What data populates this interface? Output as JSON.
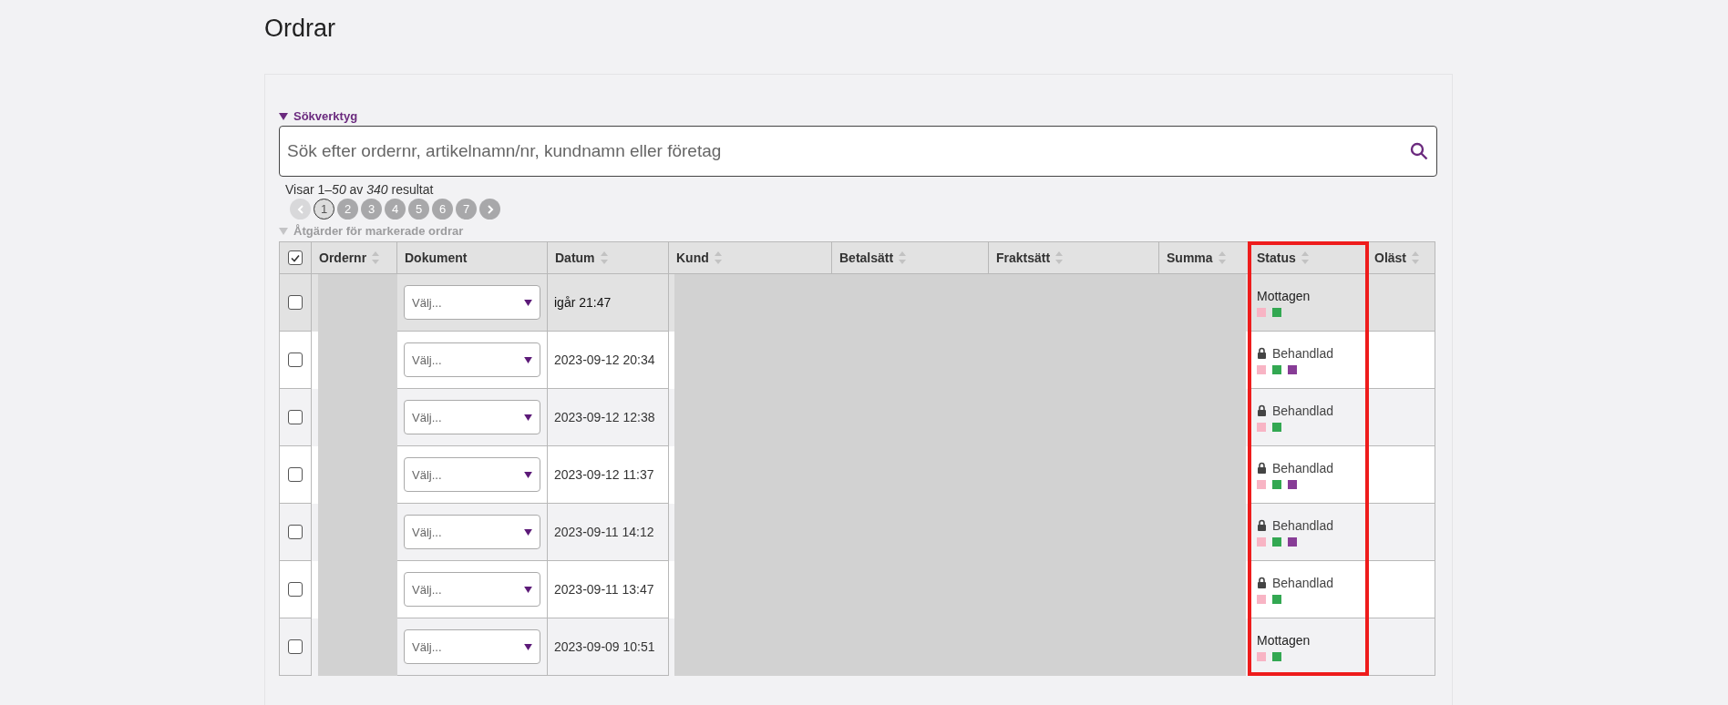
{
  "page": {
    "title": "Ordrar"
  },
  "search_tools": {
    "label": "Sökverktyg",
    "expanded": true,
    "placeholder": "Sök efter ordernr, artikelnamn/nr, kundnamn eller företag"
  },
  "results": "Visar 1–*50* av *340* resultat",
  "pagination": {
    "prev_disabled": true,
    "next_disabled": false,
    "pages": [
      {
        "label": "1",
        "selected": true
      },
      {
        "label": "2",
        "selected": false
      },
      {
        "label": "3",
        "selected": false
      },
      {
        "label": "4",
        "selected": false
      },
      {
        "label": "5",
        "selected": false
      },
      {
        "label": "6",
        "selected": false
      },
      {
        "label": "7",
        "selected": false
      }
    ]
  },
  "bulk_actions": {
    "label": "Åtgärder för markerade ordrar",
    "disabled": true
  },
  "table": {
    "select_all_checked": true,
    "columns": [
      {
        "label": "Ordernr",
        "sortable": true,
        "highlighted": false
      },
      {
        "label": "Dokument",
        "sortable": false,
        "highlighted": false
      },
      {
        "label": "Datum",
        "sortable": true,
        "highlighted": false
      },
      {
        "label": "Kund",
        "sortable": true,
        "highlighted": false
      },
      {
        "label": "Betalsätt",
        "sortable": true,
        "highlighted": false
      },
      {
        "label": "Fraktsätt",
        "sortable": true,
        "highlighted": false
      },
      {
        "label": "Summa",
        "sortable": true,
        "highlighted": false
      },
      {
        "label": "Status",
        "sortable": true,
        "highlighted": true
      },
      {
        "label": "Oläst",
        "sortable": true,
        "highlighted": false
      }
    ],
    "rows": [
      {
        "checked": false,
        "highlighted": true,
        "document": "Välj...",
        "date": "igår 21:47",
        "status": "Mottagen",
        "locked": false,
        "flags": [
          {
            "color": "#f8b4c4"
          },
          {
            "color": "#33a852"
          }
        ]
      },
      {
        "checked": false,
        "highlighted": false,
        "document": "Välj...",
        "date": "2023-09-12 20:34",
        "status": "Behandlad",
        "locked": true,
        "flags": [
          {
            "color": "#f8b4c4"
          },
          {
            "color": "#33a852"
          },
          {
            "color": "#873c96"
          }
        ]
      },
      {
        "checked": false,
        "highlighted": false,
        "document": "Välj...",
        "date": "2023-09-12 12:38",
        "status": "Behandlad",
        "locked": true,
        "flags": [
          {
            "color": "#f8b4c4"
          },
          {
            "color": "#33a852"
          }
        ]
      },
      {
        "checked": false,
        "highlighted": false,
        "document": "Välj...",
        "date": "2023-09-12 11:37",
        "status": "Behandlad",
        "locked": true,
        "flags": [
          {
            "color": "#f8b4c4"
          },
          {
            "color": "#33a852"
          },
          {
            "color": "#873c96"
          }
        ]
      },
      {
        "checked": false,
        "highlighted": false,
        "document": "Välj...",
        "date": "2023-09-11 14:12",
        "status": "Behandlad",
        "locked": true,
        "flags": [
          {
            "color": "#f8b4c4"
          },
          {
            "color": "#33a852"
          },
          {
            "color": "#873c96"
          }
        ]
      },
      {
        "checked": false,
        "highlighted": false,
        "document": "Välj...",
        "date": "2023-09-11 13:47",
        "status": "Behandlad",
        "locked": true,
        "flags": [
          {
            "color": "#f8b4c4"
          },
          {
            "color": "#33a852"
          }
        ]
      },
      {
        "checked": false,
        "highlighted": false,
        "document": "Välj...",
        "date": "2023-09-09 10:51",
        "status": "Mottagen",
        "locked": false,
        "flags": [
          {
            "color": "#f8b4c4"
          },
          {
            "color": "#33a852"
          }
        ]
      }
    ]
  }
}
